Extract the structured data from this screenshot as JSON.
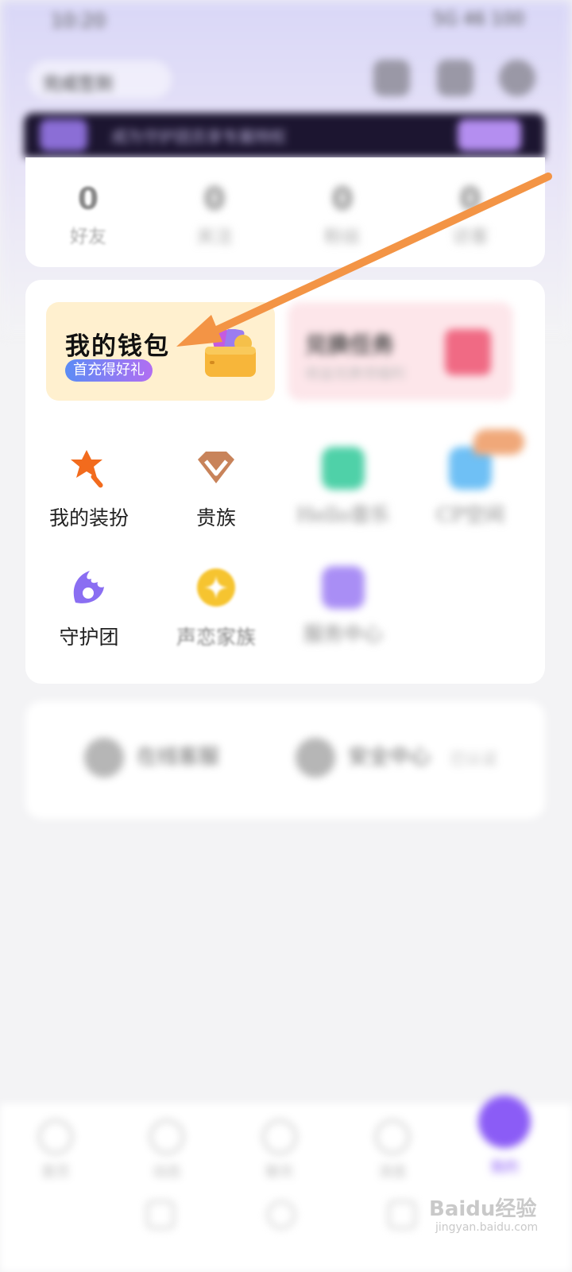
{
  "status_bar": {
    "time": "10:20",
    "right": "5G  46  100"
  },
  "top_bar": {
    "profile_label": "完成签到"
  },
  "banner": {
    "text": "成为守护团员享专属特权"
  },
  "stats": [
    {
      "num": "0",
      "label": "好友"
    },
    {
      "num": "0",
      "label": "关注"
    },
    {
      "num": "0",
      "label": "粉丝"
    },
    {
      "num": "0",
      "label": "访客"
    }
  ],
  "wallet": {
    "title": "我的钱包",
    "badge": "首充得好礼"
  },
  "task_card": {
    "title": "兑换任务",
    "subtitle": "收益兑换领福利"
  },
  "grid": {
    "dress_up": "我的装扮",
    "noble": "贵族",
    "hello_music": "Hello音乐",
    "cp_space": "CP空间",
    "guard": "守护团",
    "family": "声恋家族",
    "service": "服务中心"
  },
  "bottom_card": {
    "left": "在线客服",
    "right": "安全中心",
    "right_sub": "已认证"
  },
  "nav": {
    "items": [
      "首页",
      "动态",
      "聊天",
      "消息"
    ],
    "me": "我的"
  },
  "watermark": {
    "main": "Baidu经验",
    "sub": "jingyan.baidu.com"
  },
  "colors": {
    "accent": "#8b5cf6",
    "arrow": "#f39445",
    "wallet_bg": "#fff0cf"
  }
}
